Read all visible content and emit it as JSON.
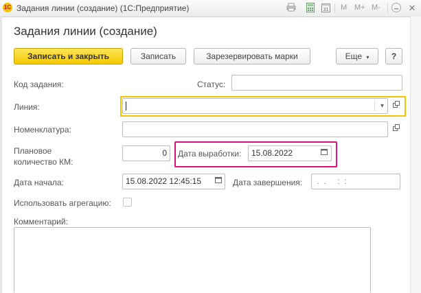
{
  "window": {
    "app_logo": "1С",
    "title": "Задания линии (создание)  (1С:Предприятие)",
    "toolbar_letters": [
      "M",
      "M+",
      "M-"
    ],
    "icons": [
      "print-icon",
      "calculator-icon",
      "calendar-icon",
      "close-icon"
    ]
  },
  "form": {
    "title": "Задания линии (создание)",
    "buttons": {
      "save_close": "Записать и закрыть",
      "save": "Записать",
      "reserve": "Зарезервировать марки",
      "more": "Еще",
      "help": "?"
    },
    "fields": {
      "code_label": "Код задания:",
      "status_label": "Статус:",
      "line_label": "Линия:",
      "line_value": "",
      "nomenclature_label": "Номенклатура:",
      "nomenclature_value": "",
      "planned_label_1": "Плановое",
      "planned_label_2": "количество КМ:",
      "planned_value": "0",
      "production_date_label": "Дата выработки:",
      "production_date_value": "15.08.2022",
      "start_label": "Дата начала:",
      "start_value": "15.08.2022 12:45:15",
      "end_label": "Дата завершения:",
      "end_value": " .  .     :  :",
      "aggregation_label": "Использовать агрегацию:",
      "aggregation_checked": false,
      "comment_label": "Комментарий:",
      "comment_value": ""
    }
  },
  "colors": {
    "primary_button": "#f5c900",
    "line_highlight": "#f5c400",
    "date_highlight": "#e0107a"
  }
}
